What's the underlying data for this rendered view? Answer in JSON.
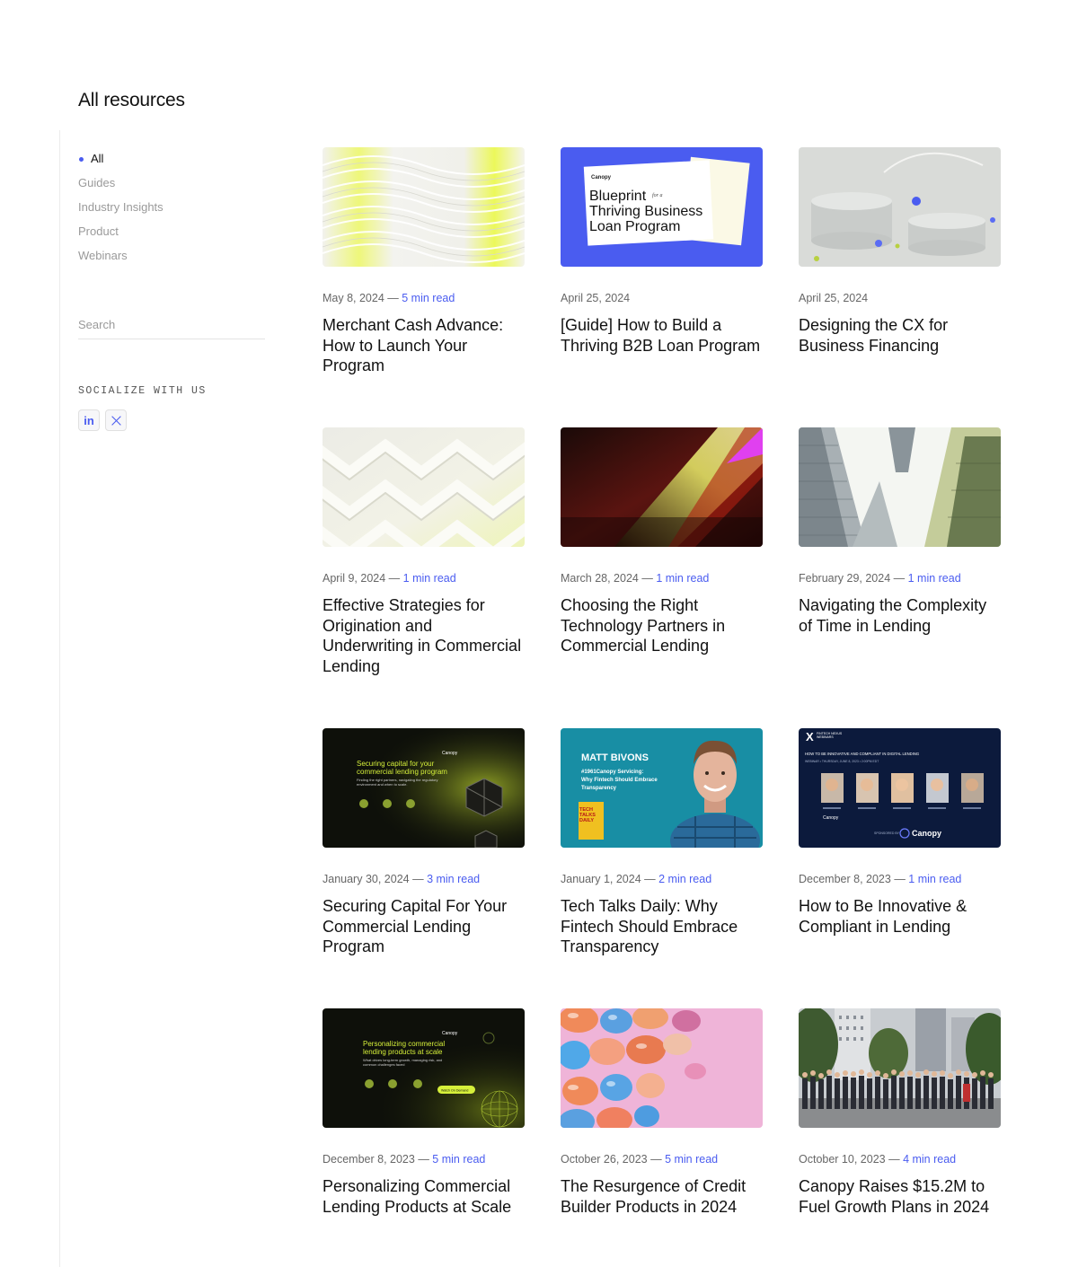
{
  "page": {
    "title": "All resources"
  },
  "filters": [
    {
      "label": "All",
      "active": true
    },
    {
      "label": "Guides",
      "active": false
    },
    {
      "label": "Industry Insights",
      "active": false
    },
    {
      "label": "Product",
      "active": false
    },
    {
      "label": "Webinars",
      "active": false
    }
  ],
  "search": {
    "placeholder": "Search"
  },
  "social": {
    "title": "SOCIALIZE WITH US",
    "linkedin_label": "in"
  },
  "cards": [
    {
      "date": "May 8, 2024",
      "read": "5 min read",
      "title": "Merchant Cash Advance: How to Launch Your Program"
    },
    {
      "date": "April 25, 2024",
      "read": "",
      "title": "[Guide] How to Build a Thriving B2B Loan Program",
      "thumb": {
        "brand": "Canopy",
        "line1": "Blueprint",
        "for": "for a",
        "line2": "Thriving Business",
        "line3": "Loan Program"
      }
    },
    {
      "date": "April 25, 2024",
      "read": "",
      "title": "Designing the CX for Business Financing"
    },
    {
      "date": "April 9, 2024",
      "read": "1 min read",
      "title": "Effective Strategies for Origination and Underwriting in Commercial Lending"
    },
    {
      "date": "March 28, 2024",
      "read": "1 min read",
      "title": "Choosing the Right Technology Partners in Commercial Lending"
    },
    {
      "date": "February 29, 2024",
      "read": "1 min read",
      "title": "Navigating the Complexity of Time in Lending"
    },
    {
      "date": "January 30, 2024",
      "read": "3 min read",
      "title": "Securing Capital For Your Commercial Lending Program",
      "thumb": {
        "brand": "Canopy",
        "line1": "Securing capital for your",
        "line2": "commercial lending program",
        "sub": "Finding the right partners, navigating the regulatory environment and when to scale."
      }
    },
    {
      "date": "January 1, 2024",
      "read": "2 min read",
      "title": "Tech Talks Daily: Why Fintech Should Embrace Transparency",
      "thumb": {
        "name": "MATT BIVONS",
        "line1": "#1961Canopy Servicing:",
        "line2": "Why Fintech Should Embrace",
        "line3": "Transparency",
        "book": "TECH TALKS DAILY"
      }
    },
    {
      "date": "December 8, 2023",
      "read": "1 min read",
      "title": "How to Be Innovative & Compliant in Lending",
      "thumb": {
        "series": "FINTECH NEXUS WEBINARS",
        "headline": "HOW TO BE INNOVATIVE AND COMPLIANT IN DIGITAL LENDING",
        "when": "WEBINAR • THURSDAY, JUNE 8, 2023 • 2:00PM EDT",
        "brand": "Canopy",
        "sponsor": "SPONSORED BY"
      }
    },
    {
      "date": "December 8, 2023",
      "read": "5 min read",
      "title": "Personalizing Commercial Lending Products at Scale",
      "thumb": {
        "brand": "Canopy",
        "line1": "Personalizing commercial",
        "line2": "lending products at scale",
        "sub": "What drives long-term growth, managing risk, and common challenges faced",
        "cta": "Watch On Demand"
      }
    },
    {
      "date": "October 26, 2023",
      "read": "5 min read",
      "title": "The Resurgence of Credit Builder Products in 2024"
    },
    {
      "date": "October 10, 2023",
      "read": "4 min read",
      "title": "Canopy Raises $15.2M to Fuel Growth Plans in 2024"
    }
  ],
  "colors": {
    "accent": "#4a5cf0",
    "text": "#111111",
    "muted": "#9a9a9a",
    "lime": "#d6f03a"
  }
}
